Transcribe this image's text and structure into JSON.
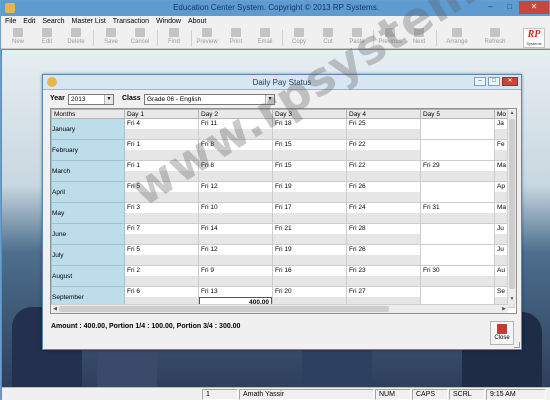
{
  "app": {
    "title": "Education Center System. Copyright © 2013 RP Systems.",
    "menu": [
      "File",
      "Edit",
      "Search",
      "Master List",
      "Transaction",
      "Window",
      "About"
    ],
    "toolbar": [
      "New",
      "Edit",
      "Delete",
      "Save",
      "Cancel",
      "Find",
      "Preview",
      "Print",
      "Email",
      "Copy",
      "Cut",
      "Paste",
      "Previous",
      "Next",
      "Arrange",
      "Refresh"
    ],
    "logo": {
      "text": "RP",
      "sub": "Systems"
    }
  },
  "dialog": {
    "title": "Daily Pay Status",
    "year_label": "Year",
    "year_value": "2013",
    "class_label": "Class",
    "class_value": "Grade 06 - English",
    "columns": [
      "Months",
      "Day 1",
      "Day 2",
      "Day 3",
      "Day 4",
      "Day 5",
      "Mo"
    ],
    "rows": [
      {
        "month": "January",
        "days": [
          "Fri 4",
          "Fri 11",
          "Fri 18",
          "Fri 25",
          "",
          "Ja"
        ]
      },
      {
        "month": "February",
        "days": [
          "Fri 1",
          "Fri 8",
          "Fri 15",
          "Fri 22",
          "",
          "Fe"
        ]
      },
      {
        "month": "March",
        "days": [
          "Fri 1",
          "Fri 8",
          "Fri 15",
          "Fri 22",
          "Fri 29",
          "Ma"
        ]
      },
      {
        "month": "April",
        "days": [
          "Fri 5",
          "Fri 12",
          "Fri 19",
          "Fri 26",
          "",
          "Ap"
        ]
      },
      {
        "month": "May",
        "days": [
          "Fri 3",
          "Fri 10",
          "Fri 17",
          "Fri 24",
          "Fri 31",
          "Ma"
        ]
      },
      {
        "month": "June",
        "days": [
          "Fri 7",
          "Fri 14",
          "Fri 21",
          "Fri 28",
          "",
          "Ju"
        ]
      },
      {
        "month": "July",
        "days": [
          "Fri 5",
          "Fri 12",
          "Fri 19",
          "Fri 26",
          "",
          "Ju"
        ]
      },
      {
        "month": "August",
        "days": [
          "Fri 2",
          "Fri 9",
          "Fri 16",
          "Fri 23",
          "Fri 30",
          "Au"
        ]
      },
      {
        "month": "September",
        "days": [
          "Fri 6",
          "Fri 13",
          "Fri 20",
          "Fri 27",
          "",
          "Se"
        ]
      }
    ],
    "highlight_amount": "400.00",
    "summary": "Amount : 400.00, Portion 1/4 : 100.00, Portion 3/4 : 300.00",
    "close_label": "Close"
  },
  "statusbar": {
    "page": "1",
    "user": "Amath Yassir",
    "num": "NUM",
    "caps": "CAPS",
    "scrl": "SCRL",
    "time": "9:15 AM"
  },
  "watermark": "www.rpsystems.lk"
}
